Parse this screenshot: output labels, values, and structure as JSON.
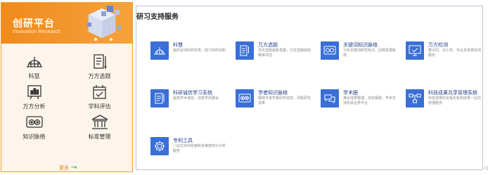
{
  "left": {
    "title": "创研平台",
    "subtitle": "Innovation Research",
    "items": [
      {
        "label": "科慧",
        "icon": "globe-grid-icon"
      },
      {
        "label": "万方选题",
        "icon": "document-pen-icon"
      },
      {
        "label": "万方分析",
        "icon": "chart-board-icon"
      },
      {
        "label": "学科评估",
        "icon": "calendar-check-icon"
      },
      {
        "label": "知识脉络",
        "icon": "knowledge-nodes-icon"
      },
      {
        "label": "标准管理",
        "icon": "institution-icon"
      }
    ],
    "more_label": "更多",
    "more_arrow": "→",
    "accent": "#f08a1c"
  },
  "right": {
    "title": "研习支持服务",
    "services": [
      {
        "name": "科慧",
        "desc": "面向全球科研态势，助力科研创新",
        "icon": "globe-grid-icon"
      },
      {
        "name": "万方选题",
        "desc": "洞见选题最新发展，已定选题获取精准评估",
        "icon": "document-pen-icon"
      },
      {
        "name": "关键词知识脉络",
        "desc": "分析关键词研究热点，回溯发展脉络",
        "icon": "search-screen-icon"
      },
      {
        "name": "万方检测",
        "desc": "着大同，识小异，专业多场景检测服务",
        "icon": "monitor-check-icon"
      },
      {
        "name": "科研诚信学习系统",
        "desc": "提高学术诚信，改善学风建设",
        "icon": "book-pen-icon"
      },
      {
        "name": "学者知识脉络",
        "desc": "跟踪专家学者研究动态，洞悉研究成果",
        "icon": "scholar-nodes-icon"
      },
      {
        "name": "学术圈",
        "desc": "满足成果整理、动态跟踪、学术交流的综合类平台",
        "icon": "chat-bubbles-icon"
      },
      {
        "name": "科技成果共享管理系统",
        "desc": "科技成果的全程化机构成果一站式管理服务",
        "icon": "flowchart-icon"
      },
      {
        "name": "专利工具",
        "desc": "一站式专利检索和多维度统计分析服务",
        "icon": "gear-icon"
      }
    ],
    "accent": "#3a6fd8"
  },
  "edge_glyph": "◁"
}
